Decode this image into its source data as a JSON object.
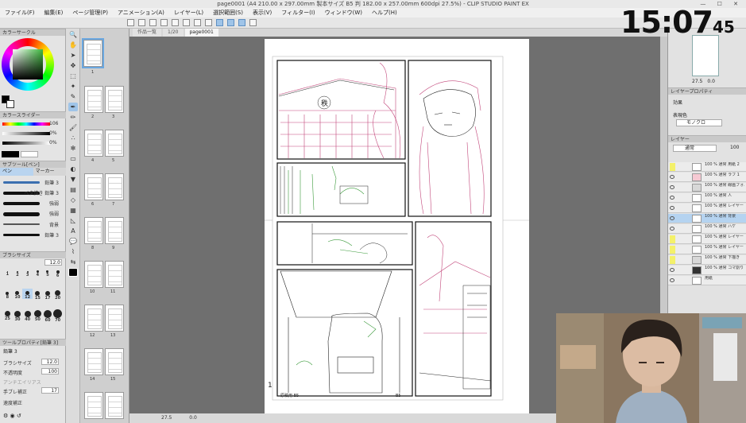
{
  "window": {
    "title": "page0001 (A4 210.00 x 297.00mm 製本サイズ B5 判 182.00 x 257.00mm 600dpi 27.5%) - CLIP STUDIO PAINT EX"
  },
  "menu": [
    "ファイル(F)",
    "編集(E)",
    "ページ管理(P)",
    "アニメーション(A)",
    "レイヤー(L)",
    "選択範囲(S)",
    "表示(V)",
    "フィルター(I)",
    "ウィンドウ(W)",
    "ヘルプ(H)"
  ],
  "tabs": [
    {
      "label": "作品一覧"
    },
    {
      "label": "1/20"
    },
    {
      "label": "page0001"
    }
  ],
  "color_panel": {
    "title": "カラーサークル",
    "sliders_title": "カラースライダー",
    "slider_values": [
      "106",
      "0%",
      "0%"
    ]
  },
  "subtool": {
    "title": "サブツール[ペン]",
    "tabs": [
      "ペン",
      "マーカー"
    ],
    "brushes": [
      {
        "label": "鉛筆 3"
      },
      {
        "label": "ベタ描き 鉛筆 3"
      },
      {
        "label": "強弱"
      },
      {
        "label": "強弱"
      },
      {
        "label": "背景"
      },
      {
        "label": "鉛筆 3"
      }
    ]
  },
  "brush_size": {
    "title": "ブラシサイズ",
    "current": "12.0",
    "sizes": [
      "1",
      "2",
      "3",
      "4",
      "5",
      "6",
      "8",
      "10",
      "12",
      "15",
      "17",
      "20",
      "25",
      "30",
      "40",
      "50",
      "60",
      "70"
    ]
  },
  "tool_property": {
    "title": "ツールプロパティ[鉛筆 3]",
    "subtitle": "鉛筆 3",
    "rows": [
      {
        "label": "ブラシサイズ",
        "value": "12.0"
      },
      {
        "label": "不透明度",
        "value": "100"
      },
      {
        "label": "アンチエイリアス",
        "value": ""
      },
      {
        "label": "手ブレ補正",
        "value": "17"
      },
      {
        "label": "速度補正",
        "value": ""
      }
    ]
  },
  "pages": [
    {
      "num": "1"
    },
    {
      "num": "2"
    },
    {
      "num": "3"
    },
    {
      "num": "4"
    },
    {
      "num": "5"
    },
    {
      "num": "6"
    },
    {
      "num": "7"
    },
    {
      "num": "8"
    },
    {
      "num": "9"
    },
    {
      "num": "10"
    },
    {
      "num": "11"
    },
    {
      "num": "12"
    },
    {
      "num": "13"
    },
    {
      "num": "14"
    },
    {
      "num": "15"
    }
  ],
  "navigator": {
    "zoom": "27.5",
    "angle": "0.0"
  },
  "layer_property": {
    "title": "レイヤープロパティ",
    "effect_label": "効果",
    "color_label": "表現色",
    "color_value": "モノクロ"
  },
  "layers": {
    "title": "レイヤー",
    "blend": "通常",
    "opacity": "100",
    "items": [
      {
        "text": "100 % 通常 用紙 2"
      },
      {
        "text": "100 % 通常 ラフ 1"
      },
      {
        "text": "100 % 通常 線画フォルダ"
      },
      {
        "text": "100 % 通常 人"
      },
      {
        "text": "100 % 通常 レイヤー 1 のコピー 2"
      },
      {
        "text": "100 % 通常 背景"
      },
      {
        "text": "100 % 通常 ハケ"
      },
      {
        "text": "100 % 通常 レイヤー 3"
      },
      {
        "text": "100 % 通常 レイヤー 2"
      },
      {
        "text": "100 % 通常 下描き"
      },
      {
        "text": "100 % 通常 コマ割り 1"
      },
      {
        "text": "用紙"
      }
    ]
  },
  "canvas": {
    "page_number": "1",
    "footer_left": "原稿用 B5",
    "footer_right": "B5"
  },
  "status": {
    "zoom": "27.5",
    "angle": "0.0"
  },
  "clock": {
    "hm": "15:07",
    "sec": "45"
  },
  "manga": {
    "shop_sign": "秩"
  }
}
